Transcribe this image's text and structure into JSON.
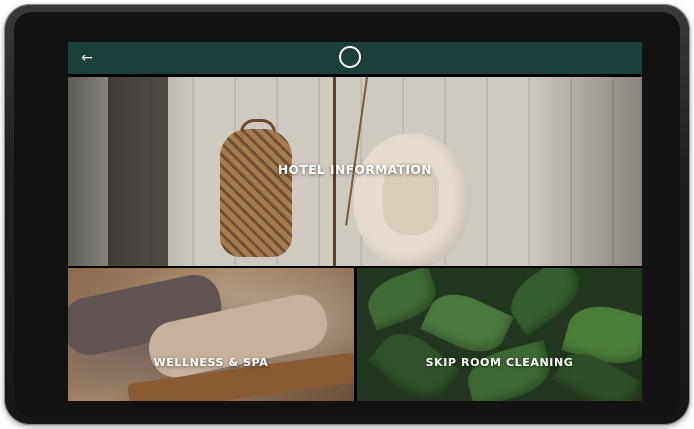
{
  "topbar": {
    "back_icon": "←",
    "background": "#1b3f3a"
  },
  "tiles": [
    {
      "label": "HOTEL INFORMATION"
    },
    {
      "label": "WELLNESS & SPA"
    },
    {
      "label": "SKIP ROOM CLEANING"
    }
  ]
}
